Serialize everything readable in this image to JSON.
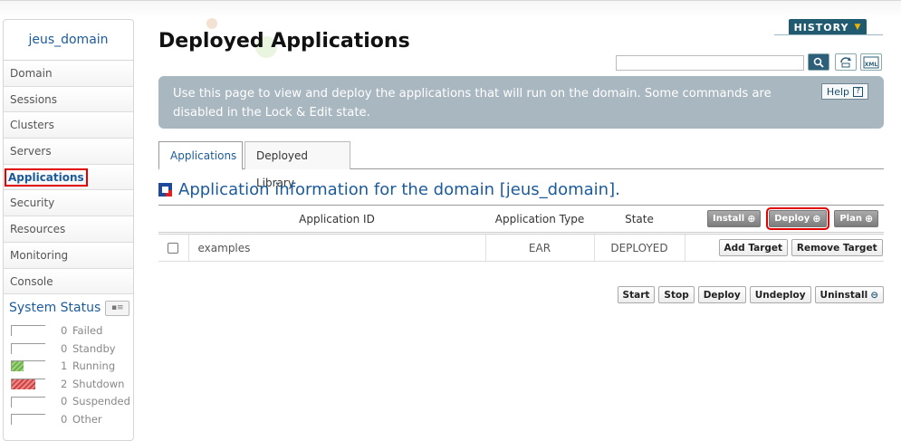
{
  "sidebar": {
    "domain": "jeus_domain",
    "items": [
      {
        "label": "Domain"
      },
      {
        "label": "Sessions"
      },
      {
        "label": "Clusters"
      },
      {
        "label": "Servers"
      },
      {
        "label": "Applications"
      },
      {
        "label": "Security"
      },
      {
        "label": "Resources"
      },
      {
        "label": "Monitoring"
      },
      {
        "label": "Console"
      }
    ],
    "active_item": "Applications",
    "system_status": {
      "title": "System Status",
      "rows": [
        {
          "count": "0",
          "label": "Failed"
        },
        {
          "count": "0",
          "label": "Standby"
        },
        {
          "count": "1",
          "label": "Running"
        },
        {
          "count": "2",
          "label": "Shutdown"
        },
        {
          "count": "0",
          "label": "Suspended"
        },
        {
          "count": "0",
          "label": "Other"
        }
      ]
    }
  },
  "header": {
    "title": "Deployed Applications",
    "history_label": "HISTORY",
    "search_value": ""
  },
  "info": {
    "text": "Use this page to view and deploy the applications that will run on the domain. Some commands are disabled in the Lock & Edit state.",
    "help_label": "Help"
  },
  "tabs": [
    {
      "label": "Applications",
      "active": true
    },
    {
      "label": "Deployed Library",
      "active": false
    }
  ],
  "section": {
    "title": "Application information for the domain [jeus_domain]."
  },
  "table": {
    "columns": [
      "Application ID",
      "Application Type",
      "State"
    ],
    "header_buttons": [
      "Install",
      "Deploy",
      "Plan"
    ],
    "rows": [
      {
        "id": "examples",
        "type": "EAR",
        "state": "DEPLOYED",
        "actions": [
          "Add Target",
          "Remove Target"
        ]
      }
    ]
  },
  "actions": [
    "Start",
    "Stop",
    "Deploy",
    "Undeploy",
    "Uninstall"
  ],
  "colors": {
    "accent": "#1c5b9b",
    "info_bg": "#a9b7c0",
    "highlight": "#e00000"
  }
}
